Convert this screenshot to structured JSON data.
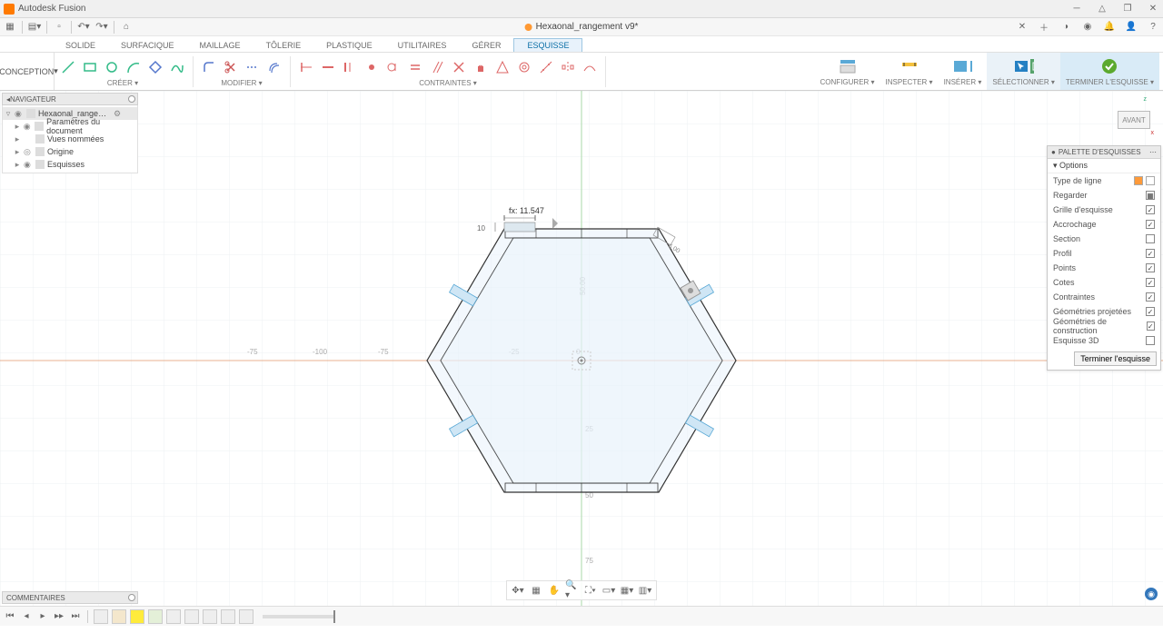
{
  "app": {
    "title": "Autodesk Fusion"
  },
  "document": {
    "name": "Hexaonal_rangement v9*"
  },
  "design_mode": "CONCEPTION",
  "ribbon_tabs": [
    "SOLIDE",
    "SURFACIQUE",
    "MAILLAGE",
    "TÔLERIE",
    "PLASTIQUE",
    "UTILITAIRES",
    "GÉRER",
    "ESQUISSE"
  ],
  "ribbon_active_tab": 7,
  "ribbon_groups": {
    "creer": "CRÉER ▾",
    "modifier": "MODIFIER ▾",
    "contraintes": "CONTRAINTES ▾",
    "configurer": "CONFIGURER ▾",
    "inspecter": "INSPECTER ▾",
    "inserer": "INSÉRER ▾",
    "selectionner": "SÉLECTIONNER ▾",
    "terminer": "TERMINER L'ESQUISSE ▾"
  },
  "browser": {
    "title": "NAVIGATEUR",
    "root": "Hexaonal_rangement v9",
    "children": [
      "Paramètres du document",
      "Vues nommées",
      "Origine",
      "Esquisses"
    ]
  },
  "viewcube": {
    "face": "AVANT",
    "x": "x",
    "z": "z"
  },
  "sketch_palette": {
    "title": "PALETTE D'ESQUISSES",
    "options_label": "▾ Options",
    "rows": [
      {
        "label": "Type de ligne",
        "control": "linetype"
      },
      {
        "label": "Regarder",
        "control": "button"
      },
      {
        "label": "Grille d'esquisse",
        "control": "check",
        "checked": true
      },
      {
        "label": "Accrochage",
        "control": "check",
        "checked": true
      },
      {
        "label": "Section",
        "control": "check",
        "checked": false
      },
      {
        "label": "Profil",
        "control": "check",
        "checked": true
      },
      {
        "label": "Points",
        "control": "check",
        "checked": true
      },
      {
        "label": "Cotes",
        "control": "check",
        "checked": true
      },
      {
        "label": "Contraintes",
        "control": "check",
        "checked": true
      },
      {
        "label": "Géométries projetées",
        "control": "check",
        "checked": true
      },
      {
        "label": "Géométries de construction",
        "control": "check",
        "checked": true
      },
      {
        "label": "Esquisse 3D",
        "control": "check",
        "checked": false
      }
    ],
    "finish_button": "Terminer l'esquisse"
  },
  "comments": {
    "title": "COMMENTAIRES"
  },
  "canvas": {
    "dimension_fx": "fx: 11.547",
    "ruler_marks": [
      "-75",
      "-100",
      "-75",
      "-25",
      "0",
      "25"
    ],
    "dim_vertical": "50.00",
    "dim_small": "10"
  }
}
